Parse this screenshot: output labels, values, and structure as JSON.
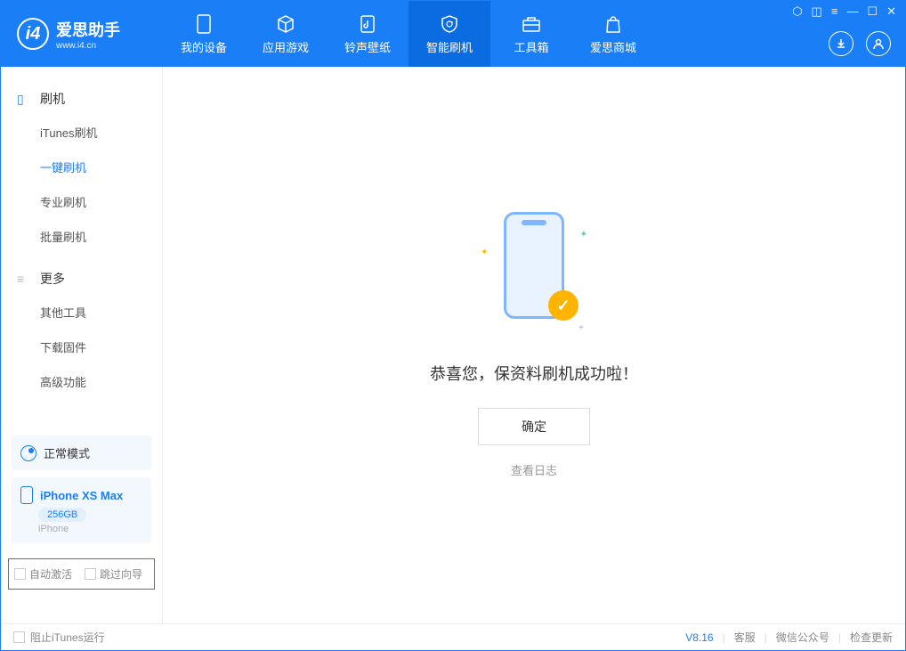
{
  "header": {
    "logo_title": "爱思助手",
    "logo_sub": "www.i4.cn",
    "nav": [
      {
        "label": "我的设备"
      },
      {
        "label": "应用游戏"
      },
      {
        "label": "铃声壁纸"
      },
      {
        "label": "智能刷机"
      },
      {
        "label": "工具箱"
      },
      {
        "label": "爱思商城"
      }
    ]
  },
  "sidebar": {
    "group1_title": "刷机",
    "group1_items": [
      "iTunes刷机",
      "一键刷机",
      "专业刷机",
      "批量刷机"
    ],
    "group2_title": "更多",
    "group2_items": [
      "其他工具",
      "下载固件",
      "高级功能"
    ],
    "mode_label": "正常模式",
    "device_name": "iPhone XS Max",
    "device_capacity": "256GB",
    "device_type": "iPhone",
    "chk1": "自动激活",
    "chk2": "跳过向导"
  },
  "main": {
    "success_text": "恭喜您，保资料刷机成功啦！",
    "ok_button": "确定",
    "log_link": "查看日志"
  },
  "footer": {
    "block_itunes": "阻止iTunes运行",
    "version": "V8.16",
    "link1": "客服",
    "link2": "微信公众号",
    "link3": "检查更新"
  }
}
